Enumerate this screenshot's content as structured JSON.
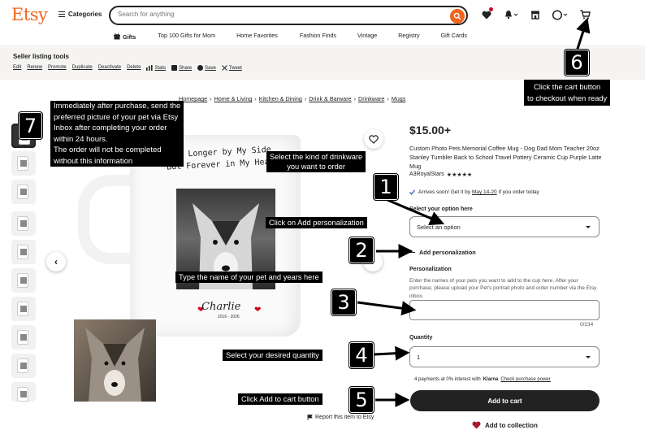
{
  "header": {
    "logo": "Etsy",
    "categories_label": "Categories",
    "search_placeholder": "Search for anything",
    "nav": [
      "Gifts",
      "Top 100 Gifts for Mom",
      "Home Favorites",
      "Fashion Finds",
      "Vintage",
      "Registry",
      "Gift Cards"
    ],
    "icons": [
      "heart-icon",
      "bell-icon",
      "shop-icon",
      "account-icon",
      "cart-icon"
    ]
  },
  "seller_tools": {
    "title": "Seller listing tools",
    "links": [
      "Edit",
      "Renew",
      "Promote",
      "Duplicate",
      "Deactivate",
      "Delete",
      "Stats",
      "Share",
      "Save",
      "Tweet"
    ]
  },
  "breadcrumb": [
    "Homepage",
    "Home & Living",
    "Kitchen & Dining",
    "Drink & Barware",
    "Drinkware",
    "Mugs"
  ],
  "product": {
    "price": "$15.00+",
    "title": "Custom Photo Pets Memorial Coffee Mug - Dog Dad Mom Teacher 20oz Stanley Tumbler Back to School Travel Pottery Ceramic Cup Purple Latte Mug",
    "shop": "A3RoyalStars",
    "stars": "★★★★★",
    "arrives_prefix": "Arrives soon! Get it by",
    "arrives_date": "May 14-20",
    "arrives_suffix": "if you order today",
    "option_label": "Select your option here",
    "option_value": "Select an option",
    "add_personalization": "Add personalization",
    "personalization_label": "Personalization",
    "personalization_desc": "Enter the names of your pets you want to add to the cup here. After your purchase, please upload your Pet's portrait photo and order number via the Etsy inbox.",
    "char_counter": "0/234",
    "quantity_label": "Quantity",
    "quantity_value": "1",
    "klarna_text": "4 payments at 0% interest with",
    "klarna_brand": "Klarna",
    "klarna_link": "Check purchase power",
    "add_to_cart": "Add to cart",
    "add_to_collection": "Add to collection",
    "report": "Report this item to Etsy"
  },
  "mug": {
    "line1": "No Longer by My Side",
    "line2": "But Forever in My Heart",
    "name": "Charlie",
    "years": "2016 - 2026"
  },
  "annotations": {
    "n1": "1",
    "n2": "2",
    "n3": "3",
    "n4": "4",
    "n5": "5",
    "n6": "6",
    "n7": "7",
    "a1": [
      "Select the kind of drinkware",
      "you want to order"
    ],
    "a2": "Click on Add personalization",
    "a3": "Type the name of your pet and years here",
    "a4": "Select your desired quantity",
    "a5": "Click  Add to cart button",
    "a6": [
      "Click the cart button",
      "to checkout when ready"
    ],
    "a7": [
      "Immediately after purchase, send the",
      "preferred picture of your pet via Etsy",
      "Inbox after completing your order",
      "within 24 hours.",
      "The order will not be completed",
      "without this information"
    ]
  },
  "colors": {
    "brand": "#f1641e",
    "cart_button": "#222222",
    "heart": "#d0021b"
  }
}
